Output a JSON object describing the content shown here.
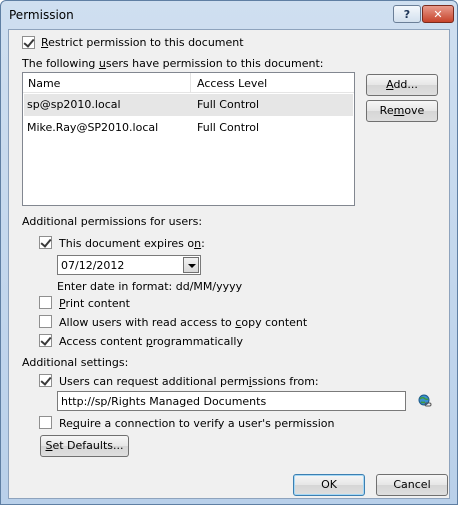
{
  "window": {
    "title": "Permission",
    "help_label": "?",
    "close_label": "✕"
  },
  "restrict": {
    "checked": true,
    "label_prefix": "",
    "label_u": "R",
    "label_rest": "estrict permission to this document"
  },
  "users": {
    "heading_pre": "The following ",
    "heading_u": "u",
    "heading_post": "sers have permission to this document:",
    "columns": [
      "Name",
      "Access Level"
    ],
    "rows": [
      {
        "name": "sp@sp2010.local",
        "access": "Full Control",
        "selected": true
      },
      {
        "name": "Mike.Ray@SP2010.local",
        "access": "Full Control",
        "selected": false
      }
    ],
    "add_pre": "",
    "add_u": "A",
    "add_post": "dd...",
    "remove_pre": "Re",
    "remove_u": "m",
    "remove_post": "ove"
  },
  "additional_permissions": {
    "heading": "Additional permissions for users:",
    "expires": {
      "checked": true,
      "label_pre": "This document expires o",
      "label_u": "n",
      "label_post": ":"
    },
    "date_value": "07/12/2012",
    "date_hint": "Enter date in format: dd/MM/yyyy",
    "print": {
      "checked": false,
      "label_pre": "",
      "label_u": "P",
      "label_post": "rint content"
    },
    "copy": {
      "checked": false,
      "label_pre": "Allow users with read access to ",
      "label_u": "c",
      "label_post": "opy content"
    },
    "programmatic": {
      "checked": true,
      "label_pre": "Access content ",
      "label_u": "p",
      "label_post": "rogrammatically"
    }
  },
  "additional_settings": {
    "heading": "Additional settings:",
    "request": {
      "checked": true,
      "label_pre": "Users can request additional perm",
      "label_u": "i",
      "label_post": "ssions from:"
    },
    "request_url": "http://sp/Rights Managed Documents",
    "require_connection": {
      "checked": false,
      "label_pre": "Re",
      "label_u": "q",
      "label_post": "uire a connection to verify a user's permission"
    },
    "set_defaults_pre": "",
    "set_defaults_u": "S",
    "set_defaults_post": "et Defaults..."
  },
  "footer": {
    "ok_label": "OK",
    "cancel_label": "Cancel"
  },
  "colors": {
    "accent": "#3c7fb1",
    "title_gradient_top": "#cfdff0",
    "client_bg": "#f0f0f0"
  },
  "icons": {
    "globe": "globe-link-icon",
    "dropdown": "chevron-down-icon"
  }
}
